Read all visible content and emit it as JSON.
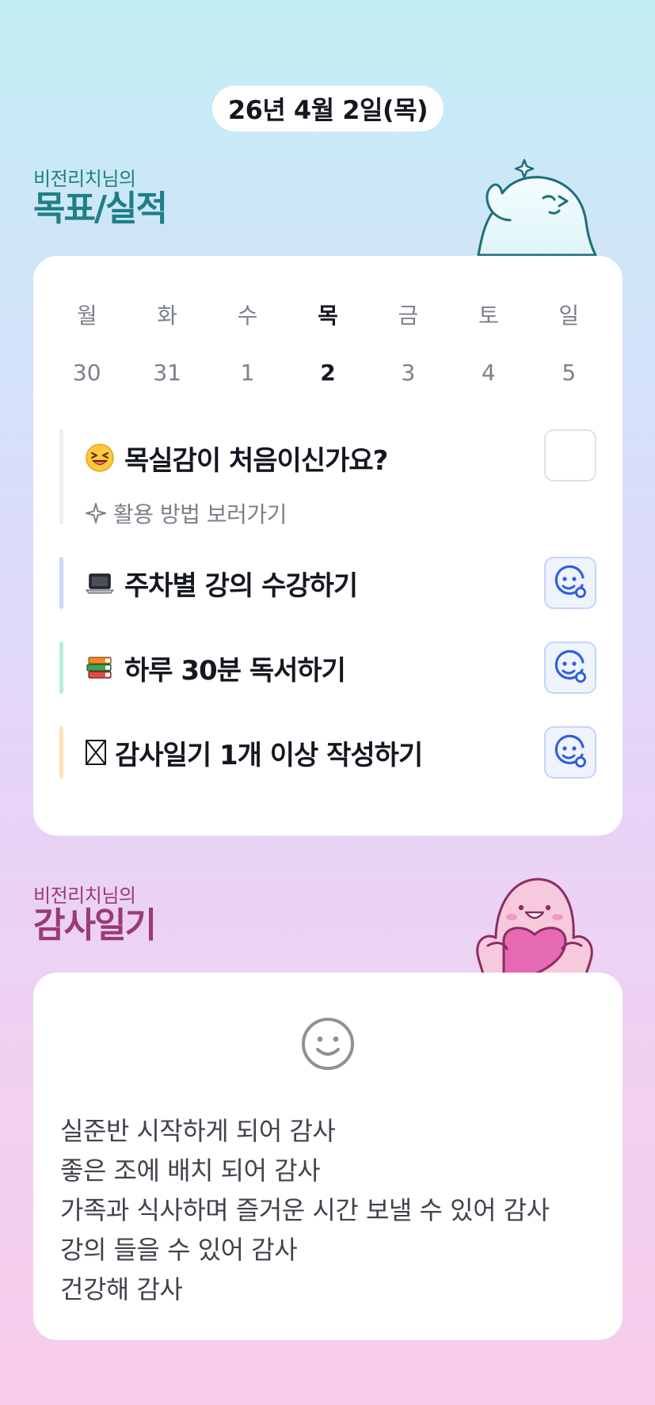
{
  "date_label": "26년 4월 2일(목)",
  "goals_section": {
    "subtitle": "비전리치님의",
    "title": "목표/실적"
  },
  "week": [
    {
      "name": "월",
      "num": "30"
    },
    {
      "name": "화",
      "num": "31"
    },
    {
      "name": "수",
      "num": "1"
    },
    {
      "name": "목",
      "num": "2",
      "active": true
    },
    {
      "name": "금",
      "num": "3"
    },
    {
      "name": "토",
      "num": "4"
    },
    {
      "name": "일",
      "num": "5"
    }
  ],
  "tasks": [
    {
      "icon": "laughing-face-icon",
      "title": "목실감이 처음이신가요?",
      "sub_link": "활용 방법 보러가기",
      "sub_icon": "sparkle-icon",
      "bar_color": "#eceef1",
      "checked": false
    },
    {
      "icon": "laptop-icon",
      "title": "주차별 강의 수강하기",
      "bar_color": "#cdd7f7",
      "checked": true
    },
    {
      "icon": "books-icon",
      "title": "하루 30분 독서하기",
      "bar_color": "#b5efd6",
      "checked": true
    },
    {
      "icon": "boxed-x-icon",
      "title": "감사일기 1개 이상 작성하기",
      "bar_color": "#fde1b8",
      "checked": true
    }
  ],
  "thanks_section": {
    "subtitle": "비전리치님의",
    "title": "감사일기"
  },
  "thanks_entries": [
    "실준반 시작하게 되어 감사",
    "좋은 조에 배치 되어 감사",
    "가족과 식사하며 즐거운 시간 보낼 수 있어 감사",
    "강의 들을 수 있어 감사",
    "건강해 감사"
  ],
  "colors": {
    "goals_title": "#1e7f86",
    "thanks_title": "#9c3a75",
    "accent_blue": "#2f5fe0"
  }
}
